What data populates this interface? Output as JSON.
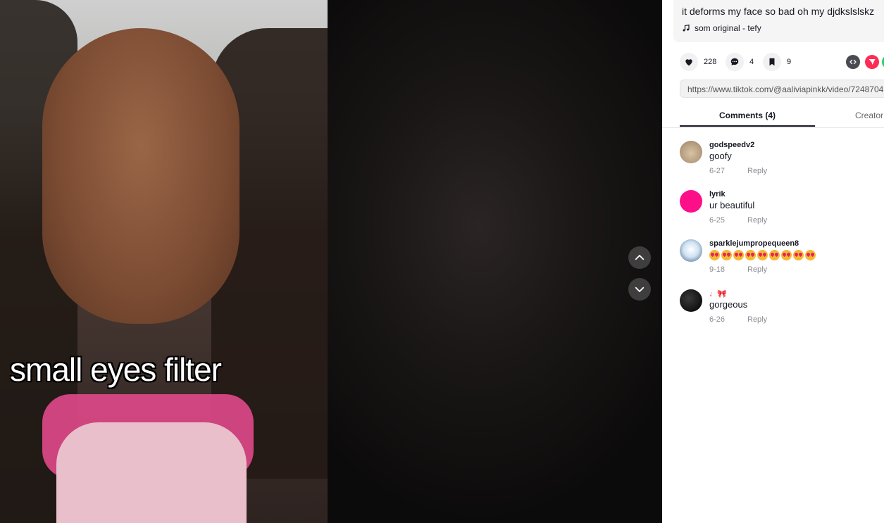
{
  "video": {
    "caption_overlay": "small eyes filter"
  },
  "description": {
    "text": "it deforms my face so bad oh my djdkslslskz",
    "music": "som original - tefy"
  },
  "actions": {
    "likes": "228",
    "comments": "4",
    "saves": "9"
  },
  "link": {
    "url": "https://www.tiktok.com/@aaliviapinkk/video/7248704"
  },
  "tabs": {
    "comments": "Comments (4)",
    "creator": "Creator"
  },
  "comments": [
    {
      "user": "godspeedv2",
      "text": "goofy",
      "date": "6-27",
      "reply": "Reply"
    },
    {
      "user": "lyrik",
      "text": "ur beautiful",
      "date": "6-25",
      "reply": "Reply"
    },
    {
      "user": "sparklejumpropequeen8",
      "text": "🤩🤩🤩🤩🤩🤩🤩🤩🤩",
      "date": "9-18",
      "reply": "Reply"
    },
    {
      "user": "♩🎀",
      "text": "gorgeous",
      "date": "6-26",
      "reply": "Reply"
    }
  ],
  "colors": {
    "text_primary": "#161823",
    "text_secondary": "#8a8b91",
    "accent_pink": "#fe2c55"
  },
  "icons": [
    "heart-icon",
    "comment-icon",
    "bookmark-icon",
    "embed-icon",
    "send-icon",
    "music-note-icon",
    "chevron-up-icon",
    "chevron-down-icon"
  ]
}
